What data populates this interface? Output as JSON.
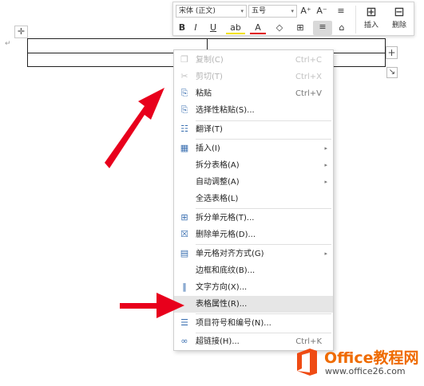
{
  "toolbar": {
    "font_name": "宋体 (正文)",
    "font_size": "五号",
    "grow_font": "A⁺",
    "shrink_font": "A⁻",
    "line_spacing": "≡",
    "bold": "B",
    "italic": "I",
    "underline": "U",
    "highlight": "ab",
    "font_color": "A",
    "fill_bucket": "◇",
    "borders": "⊞",
    "align": "≡",
    "clear": "⌂",
    "insert_label": "插入",
    "delete_label": "删除",
    "dropdown": "▾"
  },
  "table_controls": {
    "move_handle": "✛",
    "add_column": "+",
    "resize": "↘",
    "paragraph_mark": "↵"
  },
  "menu": {
    "items": [
      {
        "label": "复制(C)",
        "shortcut": "Ctrl+C",
        "icon": "❐",
        "disabled": true
      },
      {
        "label": "剪切(T)",
        "shortcut": "Ctrl+X",
        "icon": "✂",
        "disabled": true
      },
      {
        "label": "粘贴",
        "shortcut": "Ctrl+V",
        "icon": "⎘",
        "disabled": false
      },
      {
        "label": "选择性粘贴(S)...",
        "shortcut": "",
        "icon": "⎘",
        "disabled": false
      },
      {
        "label": "翻译(T)",
        "shortcut": "",
        "icon": "☷",
        "disabled": false
      },
      {
        "label": "插入(I)",
        "shortcut": "",
        "icon": "▦",
        "submenu": true
      },
      {
        "label": "拆分表格(A)",
        "shortcut": "",
        "icon": "",
        "submenu": true
      },
      {
        "label": "自动调整(A)",
        "shortcut": "",
        "icon": "",
        "submenu": true
      },
      {
        "label": "全选表格(L)",
        "shortcut": "",
        "icon": ""
      },
      {
        "label": "拆分单元格(T)...",
        "shortcut": "",
        "icon": "⊞"
      },
      {
        "label": "删除单元格(D)...",
        "shortcut": "",
        "icon": "☒"
      },
      {
        "label": "单元格对齐方式(G)",
        "shortcut": "",
        "icon": "▤",
        "submenu": true
      },
      {
        "label": "边框和底纹(B)...",
        "shortcut": "",
        "icon": ""
      },
      {
        "label": "文字方向(X)...",
        "shortcut": "",
        "icon": "‖"
      },
      {
        "label": "表格属性(R)...",
        "shortcut": "",
        "icon": "",
        "hover": true
      },
      {
        "label": "项目符号和编号(N)...",
        "shortcut": "",
        "icon": "☰"
      },
      {
        "label": "超链接(H)...",
        "shortcut": "Ctrl+K",
        "icon": "∞"
      }
    ],
    "submenu_arrow": "▸"
  },
  "watermark": {
    "brand": "Office教程网",
    "url": "www.office26.com"
  },
  "colors": {
    "accent": "#3a6fb0",
    "arrow_red": "#e8001c",
    "hover_bg": "#e6e6e6",
    "brand_orange": "#ef6b00"
  }
}
